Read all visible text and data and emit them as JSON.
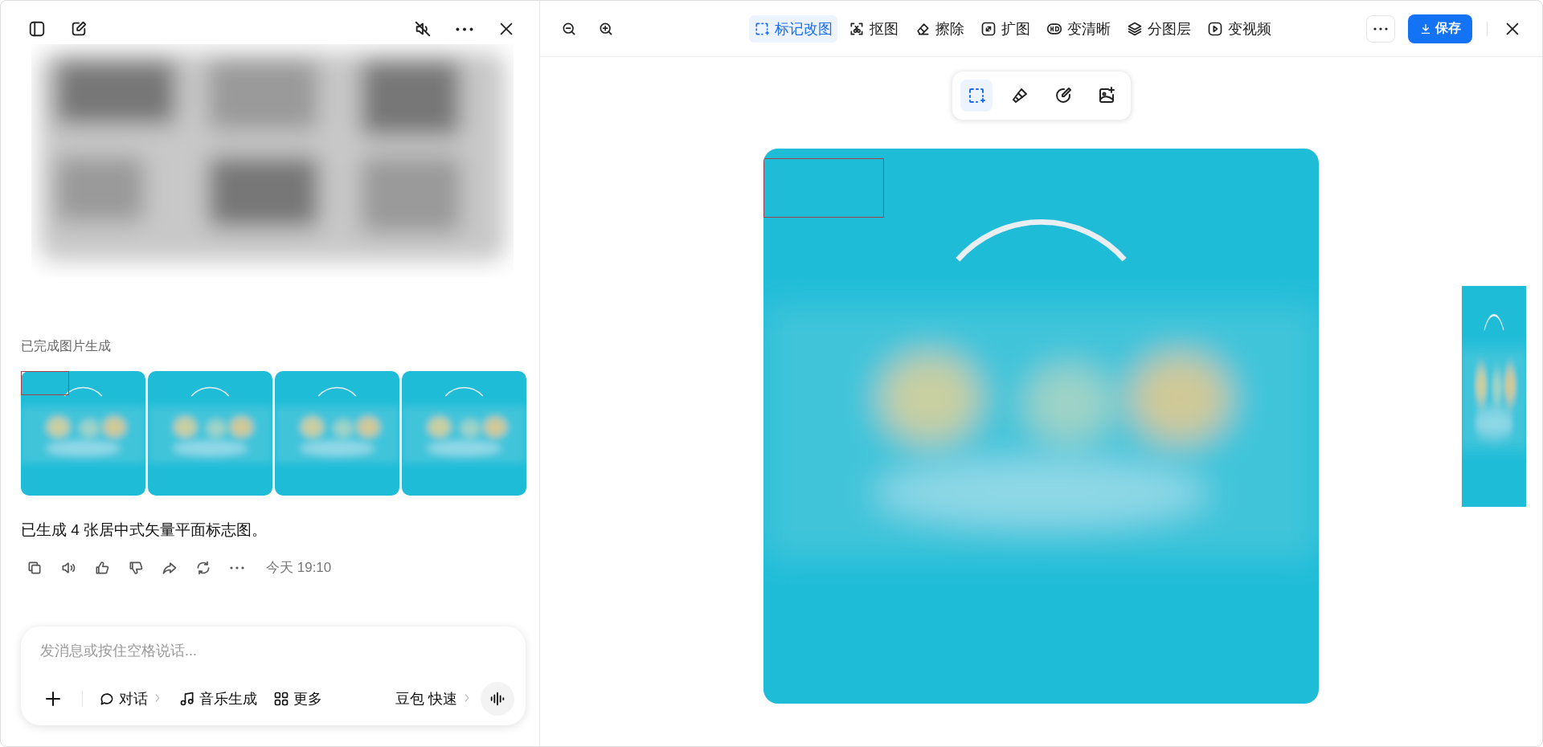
{
  "chat": {
    "status": "已完成图片生成",
    "message": "已生成 4 张居中式矢量平面标志图。",
    "time": "今天 19:10"
  },
  "composer": {
    "placeholder": "发消息或按住空格说话...",
    "chips": [
      {
        "label": "对话",
        "kind": "menu"
      },
      {
        "label": "音乐生成",
        "kind": "music"
      },
      {
        "label": "更多",
        "kind": "grid"
      }
    ],
    "model": "豆包 快速"
  },
  "editor": {
    "tools": [
      {
        "label": "标记改图",
        "kind": "mark",
        "selected": true
      },
      {
        "label": "抠图",
        "kind": "cutout",
        "selected": false
      },
      {
        "label": "擦除",
        "kind": "erase",
        "selected": false
      },
      {
        "label": "扩图",
        "kind": "expand",
        "selected": false
      },
      {
        "label": "变清晰",
        "kind": "hd",
        "selected": false
      },
      {
        "label": "分图层",
        "kind": "layers",
        "selected": false
      },
      {
        "label": "变视频",
        "kind": "video",
        "selected": false
      }
    ],
    "save": "保存",
    "subtools": [
      {
        "kind": "select",
        "selected": true
      },
      {
        "kind": "brush",
        "selected": false
      },
      {
        "kind": "pen",
        "selected": false
      },
      {
        "kind": "add-image",
        "selected": false
      }
    ]
  }
}
